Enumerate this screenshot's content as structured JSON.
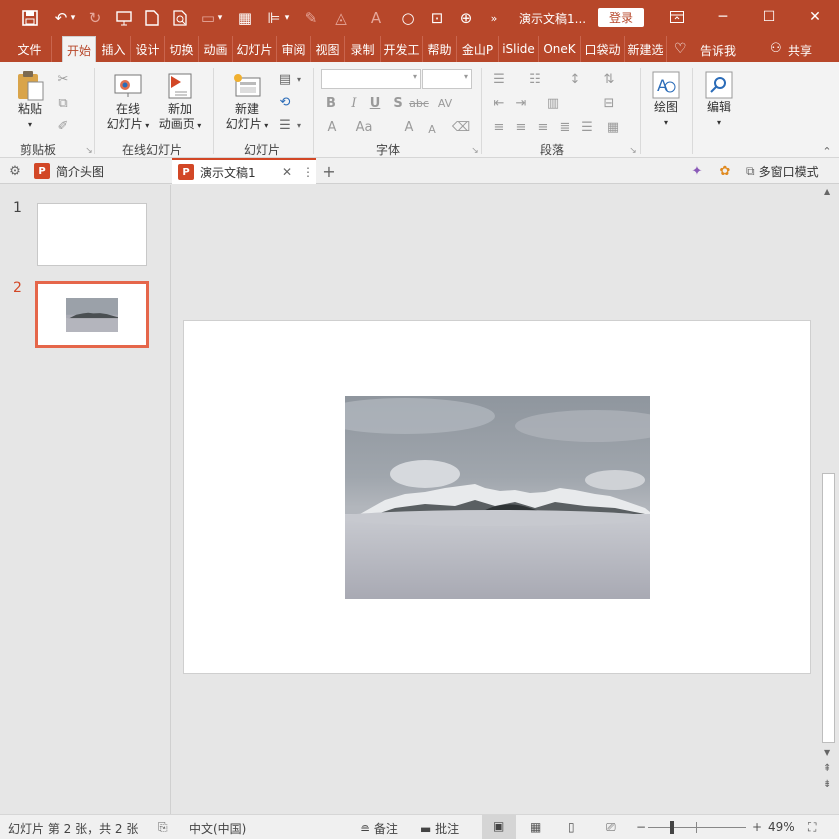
{
  "app": {
    "doc_title": "演示文稿1...",
    "login_label": "登录"
  },
  "ribbon_tabs": [
    "文件",
    "开始",
    "插入",
    "设计",
    "切换",
    "动画",
    "幻灯片",
    "审阅",
    "视图",
    "录制",
    "开发工",
    "帮助",
    "金山P",
    "iSlide",
    "OneK",
    "口袋动",
    "新建选"
  ],
  "tell_me": "告诉我",
  "share": "共享",
  "ribbon": {
    "clipboard": {
      "paste": "粘贴",
      "group": "剪贴板"
    },
    "online": {
      "online_slides_1": "在线",
      "online_slides_2": "幻灯片",
      "add_anim_1": "新加",
      "add_anim_2": "动画页",
      "group": "在线幻灯片"
    },
    "slides": {
      "new_slide_1": "新建",
      "new_slide_2": "幻灯片",
      "group": "幻灯片"
    },
    "font": {
      "group": "字体",
      "bold": "B",
      "italic": "I",
      "underline": "U",
      "shadow": "S",
      "strike": "abc",
      "font_size_up": "A",
      "font_size_down": "A",
      "font_color": "A",
      "case": "Aa"
    },
    "paragraph": {
      "group": "段落"
    },
    "drawing": {
      "label": "绘图"
    },
    "editing": {
      "label": "编辑"
    }
  },
  "doc_tabs": [
    {
      "label": "简介头图",
      "active": false
    },
    {
      "label": "演示文稿1",
      "active": true
    }
  ],
  "multi_window": "多窗口模式",
  "thumbnails": [
    {
      "num": "1",
      "selected": false
    },
    {
      "num": "2",
      "selected": true
    }
  ],
  "status": {
    "slide_info": "幻灯片 第 2 张，共 2 张",
    "language": "中文(中国)",
    "notes": "备注",
    "comments": "批注",
    "zoom": "49%"
  },
  "zoom_level": 0.49,
  "colors": {
    "accent": "#b7472a",
    "selection": "#e5664a"
  }
}
